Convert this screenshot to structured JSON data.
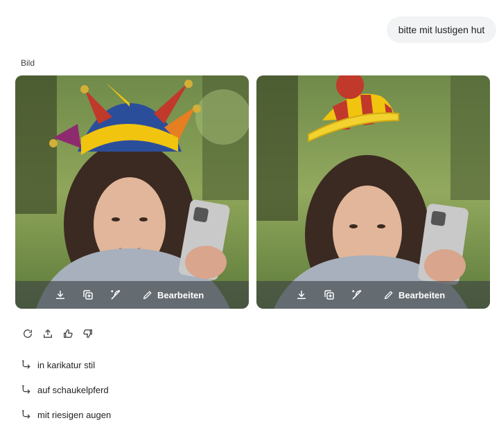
{
  "chat": {
    "user_message": "bitte mit lustigen hut",
    "section_label": "Bild"
  },
  "images": [
    {
      "hat": "jester-hat",
      "toolbar": {
        "download_icon": "download-icon",
        "copy_icon": "copy-icon",
        "share_icon": "share-icon",
        "edit_label": "Bearbeiten"
      }
    },
    {
      "hat": "pompom-hat",
      "toolbar": {
        "download_icon": "download-icon",
        "copy_icon": "copy-icon",
        "share_icon": "share-icon",
        "edit_label": "Bearbeiten"
      }
    }
  ],
  "actions": [
    "regenerate-icon",
    "share-icon",
    "thumbs-up-icon",
    "thumbs-down-icon"
  ],
  "suggestions": [
    {
      "label": "in karikatur stil"
    },
    {
      "label": "auf schaukelpferd"
    },
    {
      "label": "mit riesigen augen"
    }
  ],
  "colors": {
    "bubble_bg": "#f1f3f4",
    "toolbar_bg": "#3c4043"
  }
}
